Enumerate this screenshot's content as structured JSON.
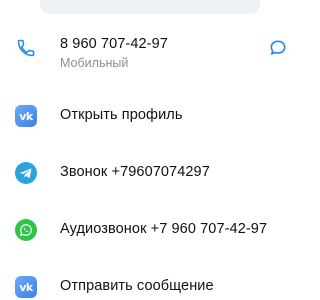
{
  "contact": {
    "phone_number": "8 960 707-42-97",
    "phone_type": "Мобильный"
  },
  "actions": {
    "open_profile": "Открыть профиль",
    "telegram_call": "Звонок +79607074297",
    "whatsapp_audio_call": "Аудиозвонок +7 960 707-42-97",
    "send_message": "Отправить сообщение"
  },
  "icons": {
    "phone": "phone-icon",
    "message": "message-bubble-icon",
    "vk": "vk-icon",
    "telegram": "telegram-icon",
    "whatsapp": "whatsapp-icon"
  },
  "colors": {
    "accent": "#2688eb",
    "vk": "#4a8ff0",
    "telegram": "#2aa3de",
    "whatsapp": "#2fc54a",
    "subtext": "#8a8f96"
  }
}
